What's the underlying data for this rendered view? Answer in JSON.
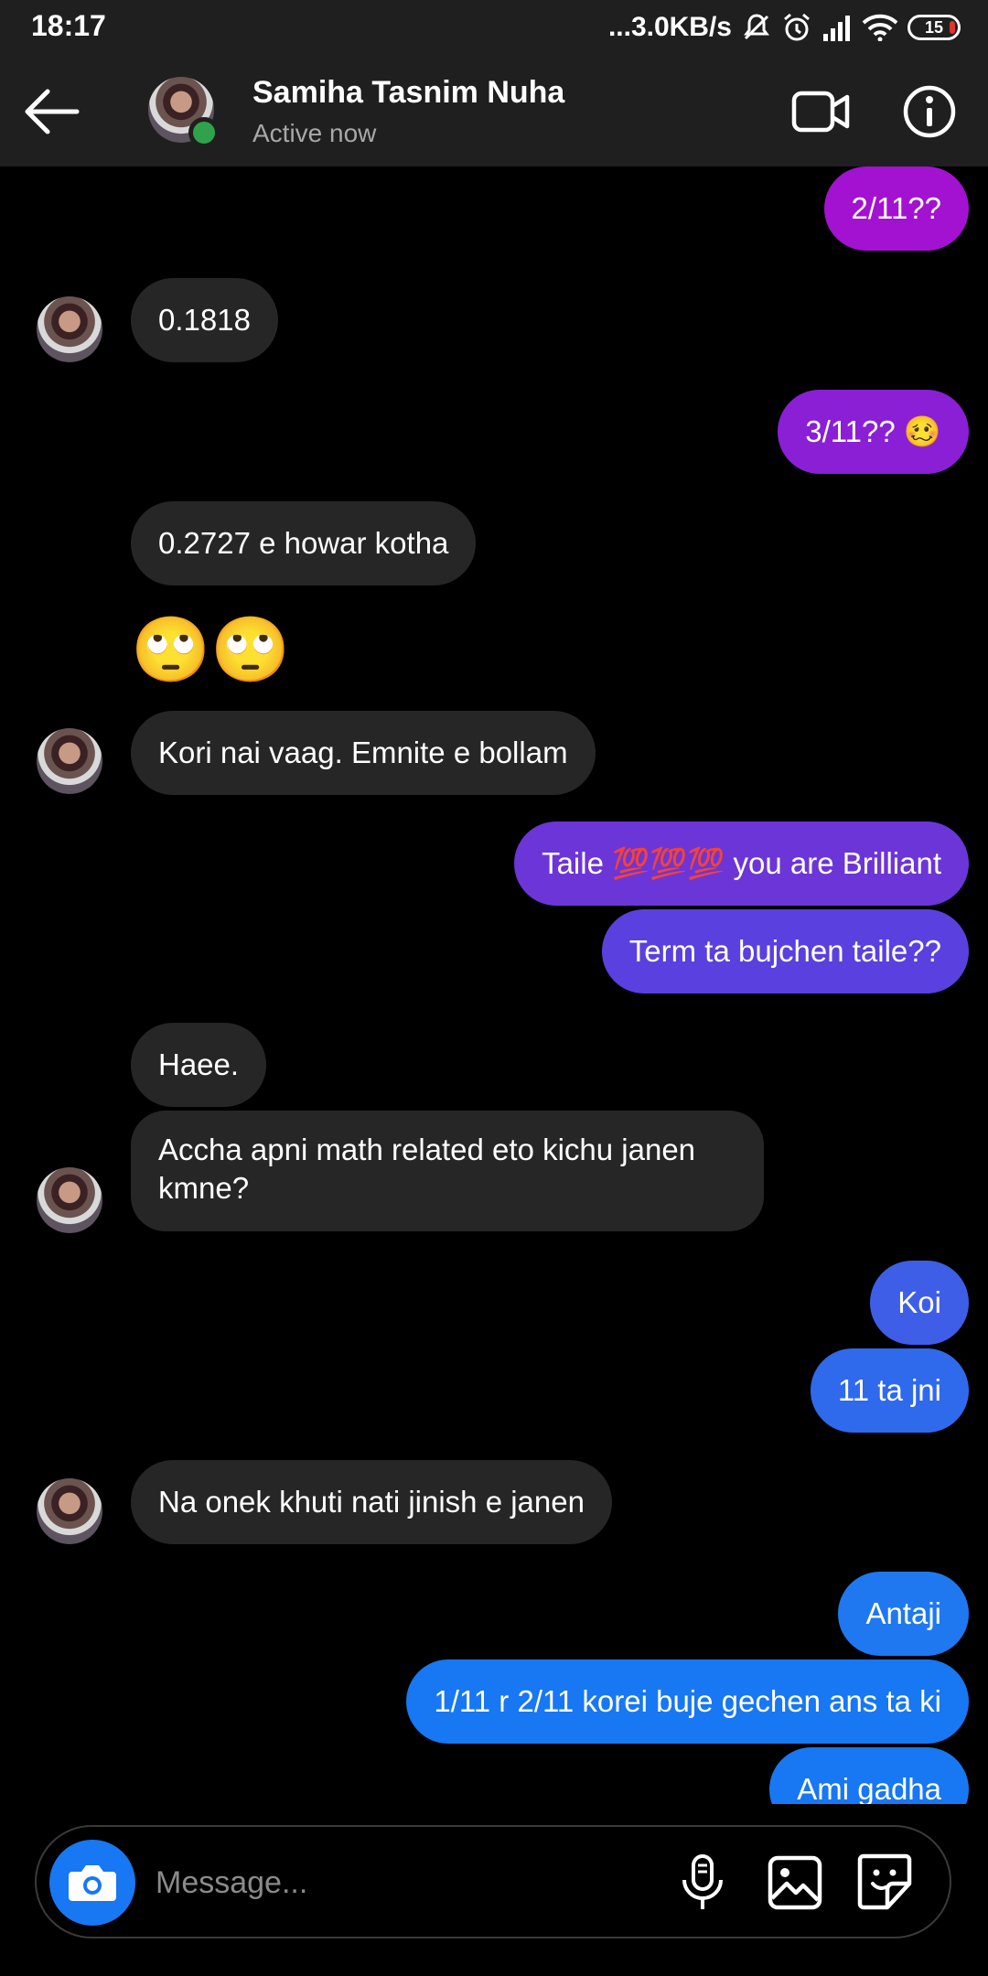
{
  "status_bar": {
    "time": "18:17",
    "network_speed": "...3.0KB/s",
    "battery": "15",
    "icons": [
      "mute-icon",
      "alarm-icon",
      "signal-icon",
      "wifi-icon",
      "battery-icon"
    ]
  },
  "header": {
    "name": "Samiha Tasnim Nuha",
    "status": "Active now",
    "icons": [
      "back-arrow-icon",
      "video-call-icon",
      "info-icon"
    ],
    "online_color": "#31a24c"
  },
  "messages": [
    {
      "dir": "out",
      "text": "2/11??"
    },
    {
      "dir": "in",
      "text": "0.1818"
    },
    {
      "dir": "out",
      "text": "3/11?? 🥴"
    },
    {
      "dir": "in",
      "text": "0.2727 e howar kotha"
    },
    {
      "dir": "in",
      "text": "🙄🙄"
    },
    {
      "dir": "in",
      "text": "Kori nai vaag. Emnite e bollam"
    },
    {
      "dir": "out",
      "text": "Taile 💯💯💯 you are Brilliant"
    },
    {
      "dir": "out",
      "text": "Term ta bujchen taile??"
    },
    {
      "dir": "in",
      "text": "Haee."
    },
    {
      "dir": "in",
      "text": "Accha apni math related eto kichu janen kmne?"
    },
    {
      "dir": "out",
      "text": "Koi"
    },
    {
      "dir": "out",
      "text": "11 ta jni"
    },
    {
      "dir": "in",
      "text": "Na onek khuti nati jinish e janen"
    },
    {
      "dir": "out",
      "text": "Antaji"
    },
    {
      "dir": "out",
      "text": "1/11 r 2/11 korei buje gechen ans ta ki"
    },
    {
      "dir": "out",
      "text": "Ami gadha"
    }
  ],
  "colors": {
    "incoming": "#262626",
    "outgoing_gradient": [
      "#a312d0",
      "#8a1fd6",
      "#6c35d8",
      "#5a40df",
      "#3e5ee8",
      "#2f69ec",
      "#1f78f0",
      "#1877f2"
    ]
  },
  "composer": {
    "placeholder": "Message...",
    "icons": [
      "camera-icon",
      "microphone-icon",
      "gallery-icon",
      "sticker-icon"
    ]
  }
}
